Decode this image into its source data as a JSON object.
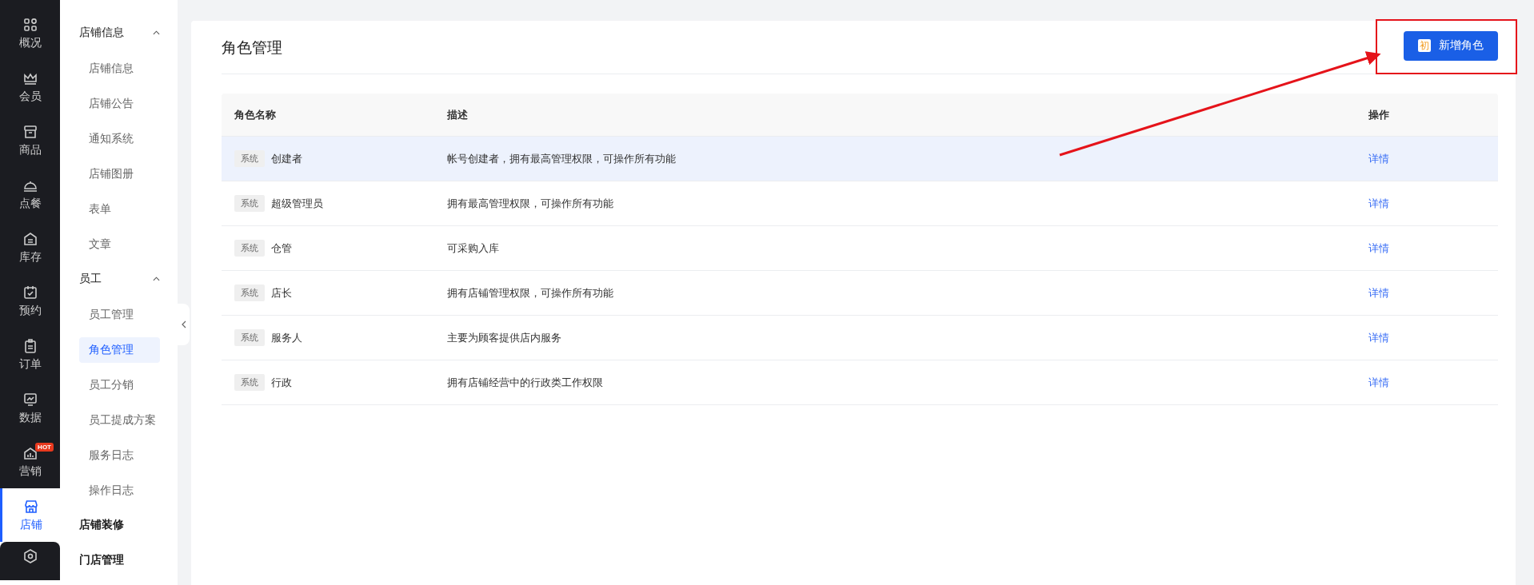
{
  "nav": [
    {
      "label": "概况",
      "selected": false
    },
    {
      "label": "会员",
      "selected": false
    },
    {
      "label": "商品",
      "selected": false
    },
    {
      "label": "点餐",
      "selected": false
    },
    {
      "label": "库存",
      "selected": false
    },
    {
      "label": "预约",
      "selected": false
    },
    {
      "label": "订单",
      "selected": false
    },
    {
      "label": "数据",
      "selected": false
    },
    {
      "label": "营销",
      "badge": "HOT",
      "selected": false
    },
    {
      "label": "店铺",
      "selected": true
    },
    {
      "selected": false
    }
  ],
  "subnav": [
    {
      "kind": "group",
      "label": "店铺信息",
      "expanded": true,
      "children": [
        {
          "label": "店铺信息",
          "selected": false
        },
        {
          "label": "店铺公告",
          "selected": false
        },
        {
          "label": "通知系统",
          "selected": false
        },
        {
          "label": "店铺图册",
          "selected": false
        },
        {
          "label": "表单",
          "selected": false
        },
        {
          "label": "文章",
          "selected": false
        }
      ]
    },
    {
      "kind": "group",
      "label": "员工",
      "expanded": true,
      "children": [
        {
          "label": "员工管理",
          "selected": false
        },
        {
          "label": "角色管理",
          "selected": true
        },
        {
          "label": "员工分销",
          "selected": false
        },
        {
          "label": "员工提成方案",
          "selected": false
        },
        {
          "label": "服务日志",
          "selected": false
        },
        {
          "label": "操作日志",
          "selected": false
        }
      ]
    },
    {
      "kind": "link",
      "label": "店铺装修"
    },
    {
      "kind": "link",
      "label": "门店管理"
    }
  ],
  "page": {
    "title": "角色管理",
    "add_button": {
      "icon_char": "初",
      "label": "新增角色"
    }
  },
  "table": {
    "columns": [
      "角色名称",
      "描述",
      "操作"
    ],
    "rows": [
      {
        "tag": "系统",
        "name": "创建者",
        "description": "帐号创建者，拥有最高管理权限，可操作所有功能",
        "action": "详情",
        "selected": true
      },
      {
        "tag": "系统",
        "name": "超级管理员",
        "description": "拥有最高管理权限，可操作所有功能",
        "action": "详情",
        "selected": false
      },
      {
        "tag": "系统",
        "name": "仓管",
        "description": "可采购入库",
        "action": "详情",
        "selected": false
      },
      {
        "tag": "系统",
        "name": "店长",
        "description": "拥有店铺管理权限，可操作所有功能",
        "action": "详情",
        "selected": false
      },
      {
        "tag": "系统",
        "name": "服务人",
        "description": "主要为顾客提供店内服务",
        "action": "详情",
        "selected": false
      },
      {
        "tag": "系统",
        "name": "行政",
        "description": "拥有店铺经营中的行政类工作权限",
        "action": "详情",
        "selected": false
      }
    ]
  }
}
